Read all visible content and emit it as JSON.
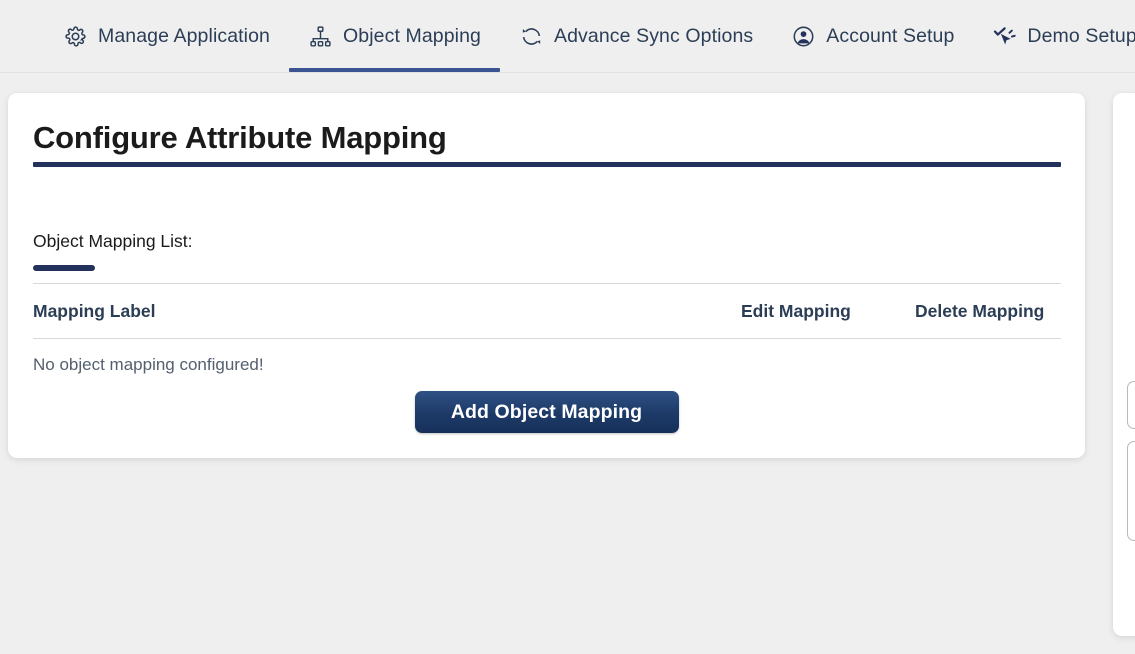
{
  "theme": {
    "page_background": "#efefef",
    "card_background": "#ffffff",
    "accent_navy": "#22325c",
    "tab_active_indicator": "#3b5390",
    "tab_label_color": "#2c3e56",
    "button_gradient_top": "#2e5184",
    "button_gradient_bottom": "#16305a",
    "muted_text": "#54606e"
  },
  "tabs": [
    {
      "id": "manage-application",
      "label": "Manage Application",
      "icon": "gear-icon",
      "active": false
    },
    {
      "id": "object-mapping",
      "label": "Object Mapping",
      "icon": "sitemap-icon",
      "active": true
    },
    {
      "id": "advance-sync-options",
      "label": "Advance Sync Options",
      "icon": "sync-icon",
      "active": false
    },
    {
      "id": "account-setup",
      "label": "Account Setup",
      "icon": "user-circle-icon",
      "active": false
    },
    {
      "id": "demo-setup",
      "label": "Demo Setup",
      "icon": "cursor-check-icon",
      "active": false
    }
  ],
  "main": {
    "title": "Configure Attribute Mapping",
    "section_label": "Object Mapping List:",
    "table": {
      "columns": [
        "Mapping Label",
        "Edit Mapping",
        "Delete Mapping"
      ],
      "rows": [],
      "empty_message": "No object mapping configured!"
    },
    "add_button_label": "Add Object Mapping"
  }
}
